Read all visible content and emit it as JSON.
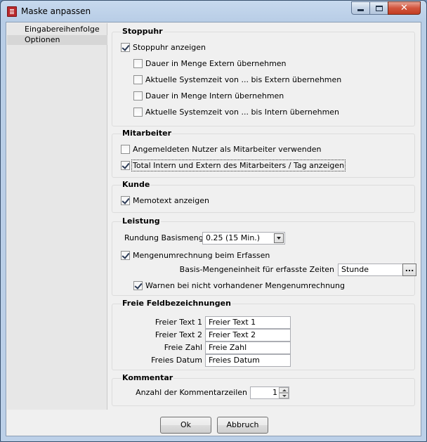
{
  "window": {
    "title": "Maske anpassen"
  },
  "nav": {
    "items": [
      {
        "label": "Eingabereihenfolge"
      },
      {
        "label": "Optionen"
      }
    ]
  },
  "stoppuhr": {
    "title": "Stoppuhr",
    "show_stopwatch": {
      "label": "Stoppuhr anzeigen",
      "checked": true
    },
    "opt1": {
      "label": "Dauer in Menge Extern übernehmen",
      "checked": false
    },
    "opt2": {
      "label": "Aktuelle Systemzeit von ... bis Extern übernehmen",
      "checked": false
    },
    "opt3": {
      "label": "Dauer in Menge Intern übernehmen",
      "checked": false
    },
    "opt4": {
      "label": "Aktuelle Systemzeit von ... bis Intern übernehmen",
      "checked": false
    }
  },
  "mitarbeiter": {
    "title": "Mitarbeiter",
    "opt1": {
      "label": "Angemeldeten Nutzer als Mitarbeiter verwenden",
      "checked": false
    },
    "opt2": {
      "label": "Total Intern und Extern des Mitarbeiters / Tag anzeigen",
      "checked": true
    }
  },
  "kunde": {
    "title": "Kunde",
    "opt1": {
      "label": "Memotext anzeigen",
      "checked": true
    }
  },
  "leistung": {
    "title": "Leistung",
    "rundung_label": "Rundung Basismenge",
    "rundung_value": "0.25 (15 Min.)",
    "mengen_cb": {
      "label": "Mengenumrechnung beim Erfassen",
      "checked": true
    },
    "basis_label": "Basis-Mengeneinheit für erfasste Zeiten",
    "basis_value": "Stunde",
    "browse_label": "...",
    "warn_cb": {
      "label": "Warnen bei nicht vorhandener Mengenumrechnung",
      "checked": true
    }
  },
  "freie": {
    "title": "Freie Feldbezeichnungen",
    "fields": [
      {
        "label": "Freier Text 1",
        "value": "Freier Text 1"
      },
      {
        "label": "Freier Text 2",
        "value": "Freier Text 2"
      },
      {
        "label": "Freie Zahl",
        "value": "Freie Zahl"
      },
      {
        "label": "Freies Datum",
        "value": "Freies Datum"
      }
    ]
  },
  "kommentar": {
    "title": "Kommentar",
    "anzahl_label": "Anzahl der Kommentarzeilen",
    "anzahl_value": "1"
  },
  "buttons": {
    "ok": "Ok",
    "cancel": "Abbruch"
  }
}
